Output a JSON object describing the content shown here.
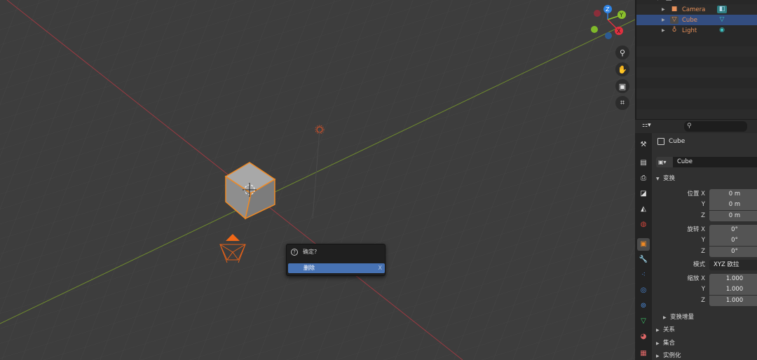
{
  "popup": {
    "title": "确定?",
    "action_label": "删除",
    "action_shortcut": "X"
  },
  "gizmo": {
    "z_label": "Z",
    "y_label": "Y",
    "x_label": "X",
    "colors": {
      "x": "#e0303f",
      "y": "#8bc02c",
      "z": "#2f83e3"
    }
  },
  "outliner": {
    "items": [
      {
        "name": "Camera",
        "icon": "camera-icon",
        "data_icon": "camera-data-icon",
        "selected": false
      },
      {
        "name": "Cube",
        "icon": "mesh-cube-icon",
        "data_icon": "mesh-data-icon",
        "selected": true
      },
      {
        "name": "Light",
        "icon": "light-icon",
        "data_icon": "light-data-icon",
        "selected": false
      }
    ]
  },
  "properties": {
    "object_name": "Cube",
    "datablock_name": "Cube",
    "transform_label": "变换",
    "location_label": "位置",
    "rotation_label": "旋转",
    "scale_label": "缩放",
    "axis": {
      "x": "X",
      "y": "Y",
      "z": "Z"
    },
    "location": {
      "x": "0 m",
      "y": "0 m",
      "z": "0 m"
    },
    "rotation": {
      "x": "0°",
      "y": "0°",
      "z": "0°"
    },
    "mode_label": "模式",
    "mode_value": "XYZ 欧拉",
    "scale": {
      "x": "1.000",
      "y": "1.000",
      "z": "1.000"
    },
    "delta_transform_label": "变换增量",
    "relations_label": "关系",
    "collections_label": "集合",
    "instancing_label": "实例化"
  },
  "colors": {
    "accent_select": "#4772b3",
    "object_orange": "#f08a24"
  }
}
